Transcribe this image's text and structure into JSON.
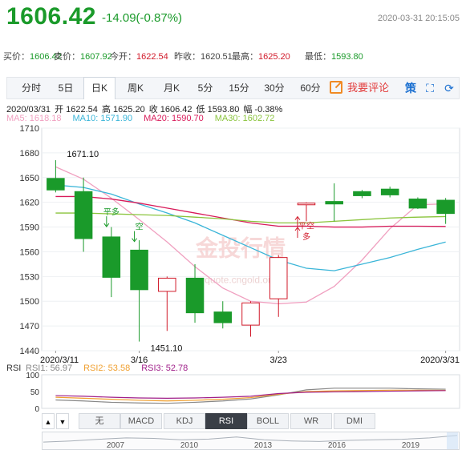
{
  "header": {
    "price": "1606.42",
    "change": "-14.09(-0.87%)",
    "time": "2020-03-31 20:15:05"
  },
  "quotes": [
    {
      "label": "买价：",
      "value": "1606.42",
      "color": "green"
    },
    {
      "label": "卖价：",
      "value": "1607.92",
      "color": "green"
    },
    {
      "label": "今开：",
      "value": "1622.54",
      "color": "red"
    },
    {
      "label": "昨收：",
      "value": "1620.51",
      "color": "normal"
    },
    {
      "label": "最高：",
      "value": "1625.20",
      "color": "red"
    },
    {
      "label": "最低：",
      "value": "1593.80",
      "color": "green"
    }
  ],
  "periods": [
    "分时",
    "5日",
    "日K",
    "周K",
    "月K",
    "5分",
    "15分",
    "30分",
    "60分"
  ],
  "active_period": "日K",
  "comment_label": "我要评论",
  "tools": {
    "brand": "策",
    "fullscreen": "⛶",
    "refresh": "⟳"
  },
  "info_line": [
    "2020/03/31",
    "开 1622.54",
    "高 1625.20",
    "收 1606.42",
    "低 1593.80",
    "幅 -0.38%"
  ],
  "ma_legend": [
    {
      "text": "MA5: 1618.18",
      "color": "#f0a0c0"
    },
    {
      "text": "MA10: 1571.90",
      "color": "#3ab5d8"
    },
    {
      "text": "MA20: 1590.70",
      "color": "#d81b5a"
    },
    {
      "text": "MA30: 1602.72",
      "color": "#8ac43c"
    }
  ],
  "chart_data": {
    "type": "candlestick",
    "ylim": [
      1440,
      1710
    ],
    "yticks": [
      "1710",
      "1680",
      "1650",
      "1620",
      "1590",
      "1560",
      "1530",
      "1500",
      "1470",
      "1440"
    ],
    "x_labels": [
      {
        "text": "2020/3/11",
        "index": 0
      },
      {
        "text": "3/16",
        "index": 3
      },
      {
        "text": "3/23",
        "index": 8
      },
      {
        "text": "2020/3/31",
        "index": 14
      }
    ],
    "candles": [
      {
        "date": "2020/3/11",
        "open": 1649,
        "close": 1635,
        "high": 1671.1,
        "low": 1632
      },
      {
        "date": "2020/3/12",
        "open": 1633,
        "close": 1576,
        "high": 1650,
        "low": 1560
      },
      {
        "date": "2020/3/13",
        "open": 1578,
        "close": 1529,
        "high": 1590,
        "low": 1505
      },
      {
        "date": "2020/3/16",
        "open": 1562,
        "close": 1514,
        "high": 1574,
        "low": 1451.1
      },
      {
        "date": "2020/3/17",
        "open": 1512,
        "close": 1528,
        "high": 1530,
        "low": 1464
      },
      {
        "date": "2020/3/18",
        "open": 1528,
        "close": 1486,
        "high": 1545,
        "low": 1474
      },
      {
        "date": "2020/3/19",
        "open": 1487,
        "close": 1474,
        "high": 1500,
        "low": 1467
      },
      {
        "date": "2020/3/20",
        "open": 1471,
        "close": 1498,
        "high": 1500,
        "low": 1457
      },
      {
        "date": "2020/3/23",
        "open": 1503,
        "close": 1553,
        "high": 1556,
        "low": 1481
      },
      {
        "date": "2020/3/24",
        "open": 1617,
        "close": 1619,
        "high": 1620,
        "low": 1597
      },
      {
        "date": "2020/3/25",
        "open": 1621,
        "close": 1618,
        "high": 1643,
        "low": 1597
      },
      {
        "date": "2020/3/26",
        "open": 1633,
        "close": 1628,
        "high": 1635,
        "low": 1625
      },
      {
        "date": "2020/3/27",
        "open": 1636,
        "close": 1629,
        "high": 1639,
        "low": 1626
      },
      {
        "date": "2020/3/30",
        "open": 1624,
        "close": 1613,
        "high": 1626,
        "low": 1612
      },
      {
        "date": "2020/3/31",
        "open": 1622.54,
        "close": 1606.42,
        "high": 1625.2,
        "low": 1593.8
      }
    ],
    "ma_series": [
      {
        "name": "MA5",
        "color": "#f0a0c0",
        "values": [
          1663,
          1648,
          1625,
          1599,
          1572,
          1542,
          1516,
          1500,
          1497,
          1499,
          1518,
          1550,
          1588,
          1617,
          1618.18
        ]
      },
      {
        "name": "MA10",
        "color": "#3ab5d8",
        "values": [
          1641,
          1638,
          1630,
          1618,
          1607,
          1595,
          1580,
          1565,
          1550,
          1540,
          1537,
          1545,
          1553,
          1563,
          1571.9
        ]
      },
      {
        "name": "MA20",
        "color": "#d81b5a",
        "values": [
          1627,
          1627,
          1624,
          1619,
          1613,
          1607,
          1601,
          1595,
          1591,
          1591,
          1590,
          1590,
          1591,
          1591,
          1590.7
        ]
      },
      {
        "name": "MA30",
        "color": "#8ac43c",
        "values": [
          1607,
          1607,
          1606,
          1605,
          1604,
          1602,
          1600,
          1597,
          1595,
          1595,
          1597,
          1599,
          1601,
          1602,
          1602.72
        ]
      }
    ],
    "extremes": [
      {
        "text": "1671.10",
        "index": 0,
        "value": 1671.1,
        "side": "high"
      },
      {
        "text": "1451.10",
        "index": 3,
        "value": 1451.1,
        "side": "low"
      }
    ],
    "signals": [
      {
        "text": "平多",
        "index": 2,
        "value": 1605,
        "arrow": "down",
        "color": "#1a9a2a"
      },
      {
        "text": "空",
        "index": 3,
        "value": 1587,
        "arrow": "down",
        "color": "#1a9a2a"
      },
      {
        "text": "平空",
        "index": 9,
        "value": 1588,
        "arrow": "up",
        "color": "#d11a2a"
      },
      {
        "text": "多",
        "index": 9,
        "value": 1575,
        "arrow": "up",
        "color": "#d11a2a"
      }
    ],
    "watermark": "金投行情",
    "watermark_url": "quote.cngold.org"
  },
  "rsi": {
    "label": "RSI",
    "legend": [
      {
        "text": "RSI1: 56.97",
        "color": "#888888"
      },
      {
        "text": "RSI2: 53.58",
        "color": "#f0a030"
      },
      {
        "text": "RSI3: 52.78",
        "color": "#a0208a"
      }
    ],
    "ylim": [
      0,
      100
    ],
    "yticks": [
      "100",
      "50",
      "0"
    ],
    "series": [
      {
        "name": "RSI1",
        "color": "#888888",
        "values": [
          25,
          22,
          18,
          16,
          15,
          18,
          22,
          28,
          40,
          55,
          60,
          60,
          60,
          58,
          56.97
        ]
      },
      {
        "name": "RSI2",
        "color": "#f0a030",
        "values": [
          33,
          30,
          27,
          24,
          22,
          24,
          27,
          32,
          42,
          50,
          52,
          53,
          54,
          54,
          53.58
        ]
      },
      {
        "name": "RSI3",
        "color": "#a0208a",
        "values": [
          38,
          36,
          33,
          31,
          30,
          31,
          33,
          36,
          44,
          48,
          49,
          50,
          51,
          52,
          52.78
        ]
      }
    ]
  },
  "indicators": [
    "无",
    "MACD",
    "KDJ",
    "RSI",
    "BOLL",
    "WR",
    "DMI"
  ],
  "active_indicator": "RSI",
  "nav": {
    "left": "▲",
    "right": "▼"
  },
  "overview": {
    "years": [
      "2007",
      "2010",
      "2013",
      "2016",
      "2019"
    ],
    "values": [
      0.35,
      0.45,
      0.6,
      0.72,
      0.68,
      0.55,
      0.62,
      0.8,
      0.55,
      0.45,
      0.4,
      0.5,
      0.55,
      0.6,
      0.72,
      0.95
    ]
  }
}
